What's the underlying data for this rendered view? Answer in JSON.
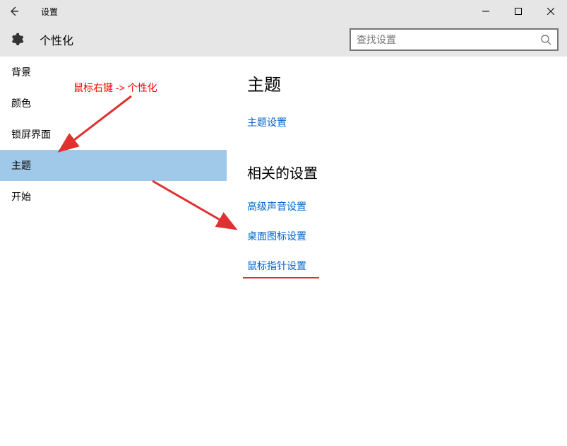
{
  "window": {
    "title": "设置"
  },
  "header": {
    "page_title": "个性化"
  },
  "search": {
    "placeholder": "查找设置"
  },
  "sidebar": {
    "items": [
      {
        "label": "背景"
      },
      {
        "label": "颜色"
      },
      {
        "label": "锁屏界面"
      },
      {
        "label": "主题",
        "selected": true
      },
      {
        "label": "开始"
      }
    ]
  },
  "content": {
    "section1_heading": "主题",
    "section1_links": [
      {
        "label": "主题设置"
      }
    ],
    "section2_heading": "相关的设置",
    "section2_links": [
      {
        "label": "高级声音设置"
      },
      {
        "label": "桌面图标设置"
      },
      {
        "label": "鼠标指针设置",
        "underlined": true
      }
    ]
  },
  "annotation": {
    "text": "鼠标右键 -> 个性化"
  }
}
